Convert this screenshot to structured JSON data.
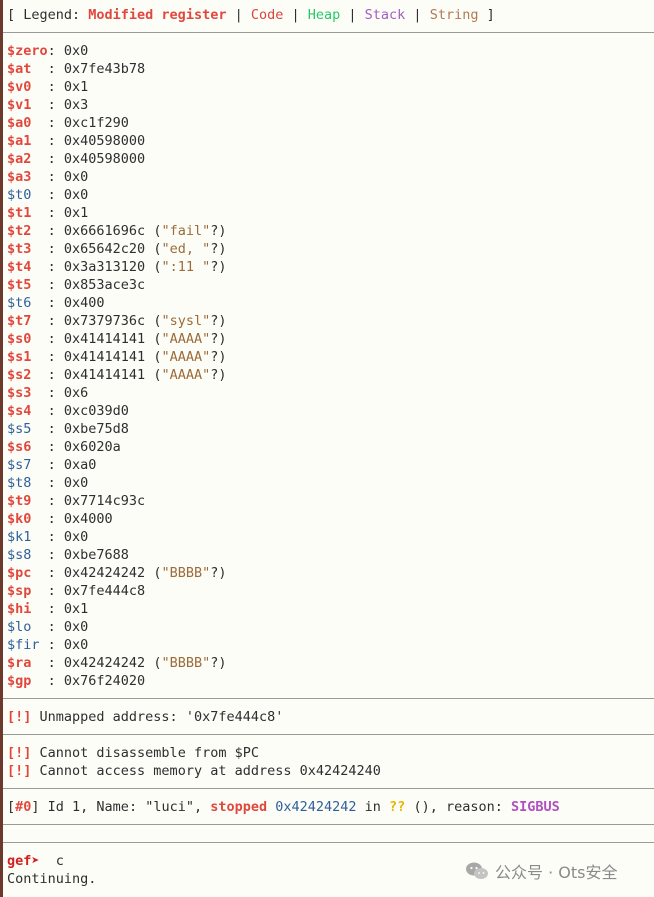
{
  "legend": {
    "open": "[ Legend: ",
    "modified": "Modified register",
    "sep": " | ",
    "code": "Code",
    "heap": "Heap",
    "stack": "Stack",
    "string": "String",
    "close": " ]"
  },
  "registers": [
    {
      "name": "$zero",
      "pad": ": ",
      "value": "0x0",
      "comment": "",
      "modified": true
    },
    {
      "name": "$at",
      "pad": "  : ",
      "value": "0x7fe43b78",
      "comment": "",
      "modified": true
    },
    {
      "name": "$v0",
      "pad": "  : ",
      "value": "0x1",
      "comment": "",
      "modified": true
    },
    {
      "name": "$v1",
      "pad": "  : ",
      "value": "0x3",
      "comment": "",
      "modified": true
    },
    {
      "name": "$a0",
      "pad": "  : ",
      "value": "0xc1f290",
      "comment": "",
      "modified": true
    },
    {
      "name": "$a1",
      "pad": "  : ",
      "value": "0x40598000",
      "comment": "",
      "modified": true
    },
    {
      "name": "$a2",
      "pad": "  : ",
      "value": "0x40598000",
      "comment": "",
      "modified": true
    },
    {
      "name": "$a3",
      "pad": "  : ",
      "value": "0x0",
      "comment": "",
      "modified": true
    },
    {
      "name": "$t0",
      "pad": "  : ",
      "value": "0x0",
      "comment": "",
      "modified": false
    },
    {
      "name": "$t1",
      "pad": "  : ",
      "value": "0x1",
      "comment": "",
      "modified": true
    },
    {
      "name": "$t2",
      "pad": "  : ",
      "value": "0x6661696c",
      "comment": "\"fail\"",
      "modified": true
    },
    {
      "name": "$t3",
      "pad": "  : ",
      "value": "0x65642c20",
      "comment": "\"ed, \"",
      "modified": true
    },
    {
      "name": "$t4",
      "pad": "  : ",
      "value": "0x3a313120",
      "comment": "\":11 \"",
      "modified": true
    },
    {
      "name": "$t5",
      "pad": "  : ",
      "value": "0x853ace3c",
      "comment": "",
      "modified": true
    },
    {
      "name": "$t6",
      "pad": "  : ",
      "value": "0x400",
      "comment": "",
      "modified": false
    },
    {
      "name": "$t7",
      "pad": "  : ",
      "value": "0x7379736c",
      "comment": "\"sysl\"",
      "modified": true
    },
    {
      "name": "$s0",
      "pad": "  : ",
      "value": "0x41414141",
      "comment": "\"AAAA\"",
      "modified": true
    },
    {
      "name": "$s1",
      "pad": "  : ",
      "value": "0x41414141",
      "comment": "\"AAAA\"",
      "modified": true
    },
    {
      "name": "$s2",
      "pad": "  : ",
      "value": "0x41414141",
      "comment": "\"AAAA\"",
      "modified": true
    },
    {
      "name": "$s3",
      "pad": "  : ",
      "value": "0x6",
      "comment": "",
      "modified": true
    },
    {
      "name": "$s4",
      "pad": "  : ",
      "value": "0xc039d0",
      "comment": "",
      "modified": true
    },
    {
      "name": "$s5",
      "pad": "  : ",
      "value": "0xbe75d8",
      "comment": "",
      "modified": false
    },
    {
      "name": "$s6",
      "pad": "  : ",
      "value": "0x6020a",
      "comment": "",
      "modified": true
    },
    {
      "name": "$s7",
      "pad": "  : ",
      "value": "0xa0",
      "comment": "",
      "modified": false
    },
    {
      "name": "$t8",
      "pad": "  : ",
      "value": "0x0",
      "comment": "",
      "modified": false
    },
    {
      "name": "$t9",
      "pad": "  : ",
      "value": "0x7714c93c",
      "comment": "",
      "modified": true
    },
    {
      "name": "$k0",
      "pad": "  : ",
      "value": "0x4000",
      "comment": "",
      "modified": true
    },
    {
      "name": "$k1",
      "pad": "  : ",
      "value": "0x0",
      "comment": "",
      "modified": false
    },
    {
      "name": "$s8",
      "pad": "  : ",
      "value": "0xbe7688",
      "comment": "",
      "modified": false
    },
    {
      "name": "$pc",
      "pad": "  : ",
      "value": "0x42424242",
      "comment": "\"BBBB\"",
      "modified": true
    },
    {
      "name": "$sp",
      "pad": "  : ",
      "value": "0x7fe444c8",
      "comment": "",
      "modified": true
    },
    {
      "name": "$hi",
      "pad": "  : ",
      "value": "0x1",
      "comment": "",
      "modified": true
    },
    {
      "name": "$lo",
      "pad": "  : ",
      "value": "0x0",
      "comment": "",
      "modified": false
    },
    {
      "name": "$fir",
      "pad": " : ",
      "value": "0x0",
      "comment": "",
      "modified": false
    },
    {
      "name": "$ra",
      "pad": "  : ",
      "value": "0x42424242",
      "comment": "\"BBBB\"",
      "modified": true
    },
    {
      "name": "$gp",
      "pad": "  : ",
      "value": "0x76f24020",
      "comment": "",
      "modified": true
    }
  ],
  "warnings": {
    "tag": "[!]",
    "unmapped": " Unmapped address: '0x7fe444c8'",
    "disasm": " Cannot disassemble from $PC",
    "memory": " Cannot access memory at address 0x42424240"
  },
  "thread": {
    "open": "[",
    "id_tag": "#0",
    "middle": "] Id 1, Name: \"luci\", ",
    "state": "stopped",
    "addr": " 0x42424242",
    "in": " in ",
    "func": "??",
    "reason_label": " (), reason: ",
    "reason": "SIGBUS"
  },
  "prompt": {
    "label": "gef➤",
    "command": "  c",
    "output": "Continuing."
  },
  "watermark": {
    "text": "公众号 · Ots安全"
  },
  "colors": {
    "modified": "#e0483d",
    "register": "#2f5f9a",
    "heap": "#26c96a",
    "stack": "#a35ec2",
    "string": "#b07a52"
  }
}
